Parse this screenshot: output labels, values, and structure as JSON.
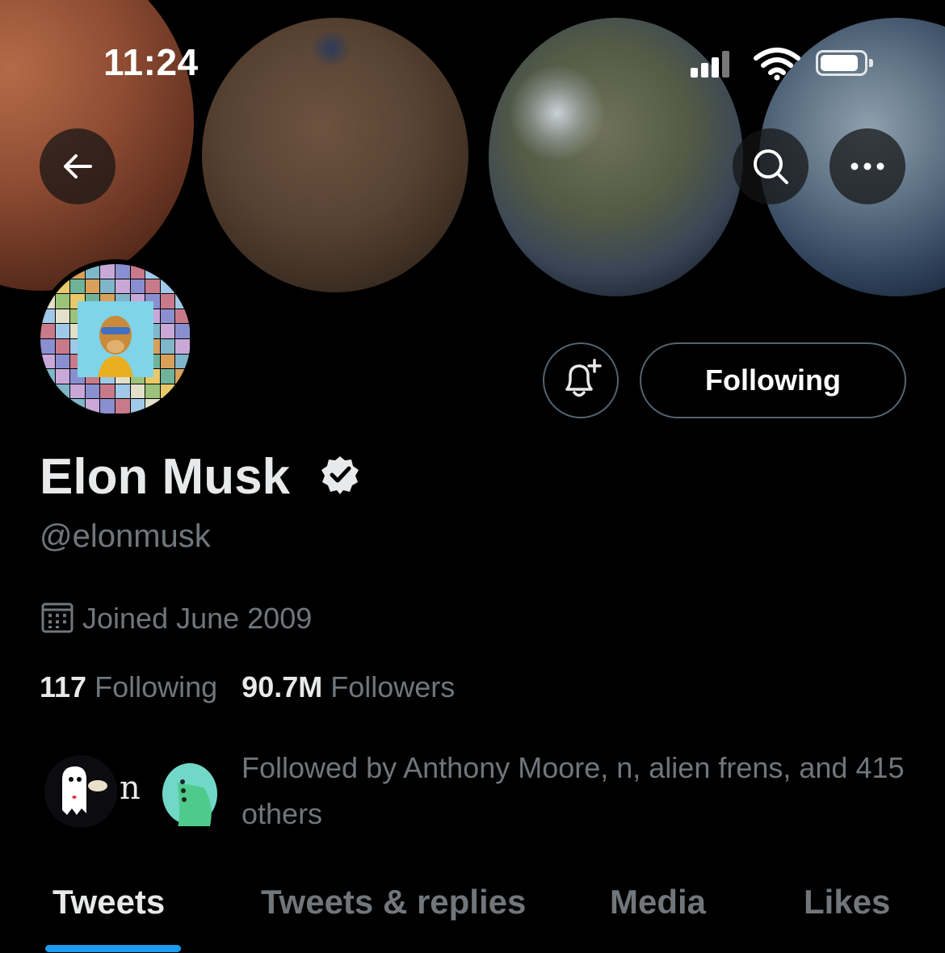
{
  "status_bar": {
    "time": "11:24"
  },
  "header_actions": {
    "follow_button": "Following"
  },
  "profile": {
    "name": "Elon Musk",
    "handle": "@elonmusk",
    "joined": "Joined June 2009",
    "following_count": "117",
    "following_label": "Following",
    "followers_count": "90.7M",
    "followers_label": "Followers"
  },
  "followed_by": {
    "middle_avatar_letter": "n",
    "text": "Followed by Anthony Moore, n, alien frens, and 415 others"
  },
  "tabs": [
    {
      "label": "Tweets",
      "active": true
    },
    {
      "label": "Tweets & replies",
      "active": false
    },
    {
      "label": "Media",
      "active": false
    },
    {
      "label": "Likes",
      "active": false
    }
  ],
  "colors": {
    "accent": "#1d9bf0",
    "secondary_text": "#71767b",
    "primary_text": "#e7e9ea"
  },
  "icons": [
    "back-arrow-icon",
    "search-icon",
    "more-icon",
    "bell-plus-icon",
    "verified-badge-icon",
    "calendar-icon"
  ]
}
